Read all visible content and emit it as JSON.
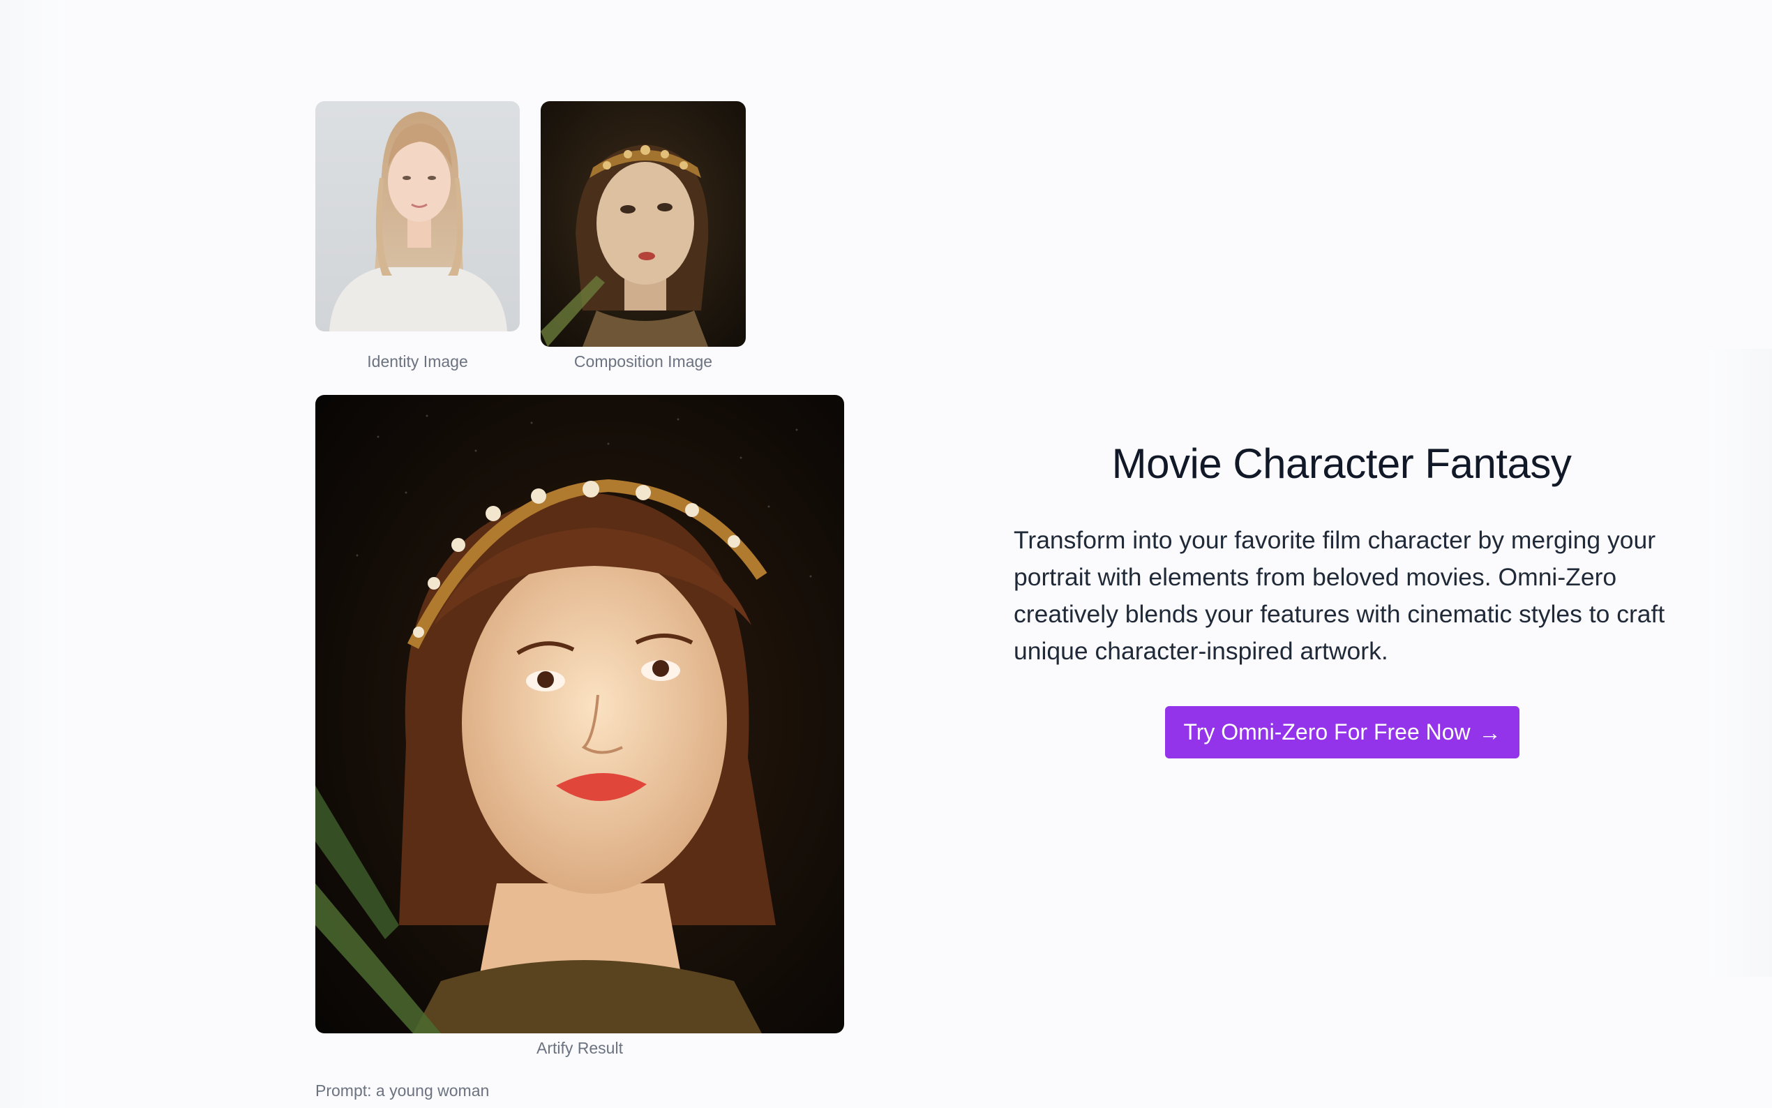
{
  "gallery": {
    "identity_caption": "Identity Image",
    "composition_caption": "Composition Image",
    "result_caption": "Artify Result",
    "prompt": "Prompt: a young woman"
  },
  "feature": {
    "title": "Movie Character Fantasy",
    "description": "Transform into your favorite film character by merging your portrait with elements from beloved movies. Omni-Zero creatively blends your features with cinematic styles to craft unique character-inspired artwork.",
    "cta_label": "Try Omni-Zero For Free Now",
    "cta_icon": "arrow-right-icon",
    "cta_glyph": "→"
  },
  "colors": {
    "accent": "#9333ea",
    "background": "#fbfbfd",
    "title_text": "#111827",
    "caption_text": "#6b7280"
  }
}
